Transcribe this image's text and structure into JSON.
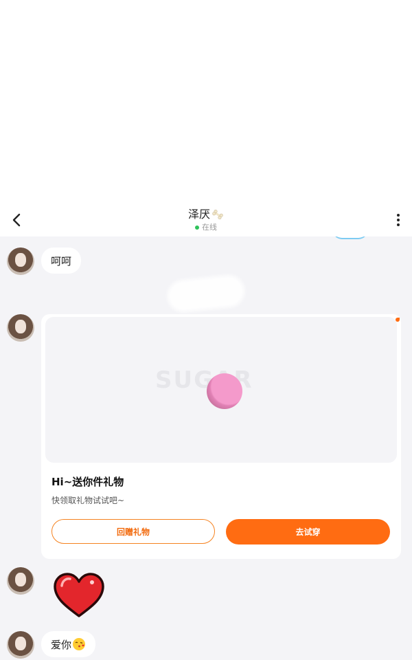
{
  "header": {
    "title": "泽厌",
    "title_emoji_icon": "bone-icon",
    "status": "在线",
    "status_color": "#2fc25b"
  },
  "messages": [
    {
      "type": "text",
      "text": "呵呵"
    },
    {
      "type": "gift_card",
      "title": "Hi~送你件礼物",
      "subtitle": "快领取礼物试试吧~",
      "secondary_button": "回赠礼物",
      "primary_button": "去试穿",
      "watermark": "SUGAR"
    },
    {
      "type": "sticker",
      "sticker_icon": "red-heart-icon"
    },
    {
      "type": "text",
      "text": "爱你",
      "emoji_icon": "face-blowing-kiss-icon"
    }
  ],
  "colors": {
    "accent": "#ff6c12",
    "chat_background": "#f4f4f7"
  }
}
